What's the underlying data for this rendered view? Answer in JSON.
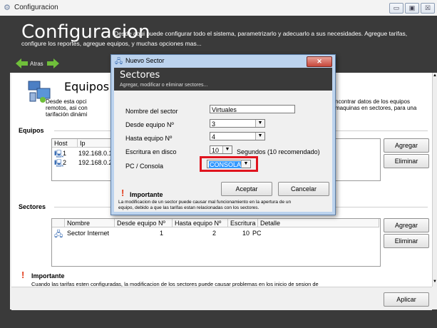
{
  "window": {
    "title": "Configuracion",
    "min_glyph": "▭",
    "max_glyph": "▣",
    "close_glyph": "☒"
  },
  "header": {
    "title": "Configuracion",
    "description_line1": "Desde aqui puede configurar todo el sistema, parametrizarlo y adecuarlo a sus necesidades. Agregue tarifas,",
    "description_line2": "configure los reportes, agregue equipos, y muchas opciones mas..."
  },
  "nav": {
    "back_label": "Atras",
    "back_icon": "arrow-left-icon",
    "forward_icon": "arrow-right-icon",
    "arrow_color": "#6fbf3a"
  },
  "equipos_panel": {
    "title": "Equipos",
    "desc_left_1": "Desde esta opci",
    "desc_left_2": "remotos, asi con",
    "desc_left_3": "tarifación dinámi",
    "desc_right_1": "ncontrar datos de los equipos",
    "desc_right_2": "maquinas en sectores, para una",
    "section_label": "Equipos",
    "columns": [
      "Host",
      "Ip"
    ],
    "rows": [
      {
        "host": "1",
        "ip": "192.168.0.1"
      },
      {
        "host": "2",
        "ip": "192.168.0.2"
      }
    ],
    "add_label": "Agregar",
    "remove_label": "Eliminar"
  },
  "sectores_panel": {
    "section_label": "Sectores",
    "columns": [
      "Nombre",
      "Desde equipo Nº",
      "Hasta equipo Nº",
      "Escritura",
      "Detalle"
    ],
    "rows": [
      {
        "nombre": "Sector Internet",
        "desde": "1",
        "hasta": "2",
        "escritura": "10",
        "detalle": "PC"
      }
    ],
    "add_label": "Agregar",
    "remove_label": "Eliminar"
  },
  "important_main": {
    "title": "Importante",
    "text": "Cuando las tarifas esten configuradas, la modificacion de los sectores puede causar problemas en los inicio de sesion de"
  },
  "apply_label": "Aplicar",
  "dialog": {
    "window_title": "Nuevo Sector",
    "close_glyph": "✕",
    "heading": "Sectores",
    "subheading": "Agregar, modificar o eliminar sectores...",
    "fields": {
      "nombre_label": "Nombre del sector",
      "nombre_value": "Virtuales",
      "desde_label": "Desde equipo Nº",
      "desde_value": "3",
      "hasta_label": "Hasta equipo Nº",
      "hasta_value": "4",
      "escritura_label": "Escritura en disco",
      "escritura_value": "10",
      "escritura_suffix": "Segundos (10 recomendado)",
      "pc_label": "PC / Consola",
      "pc_value": "CONSOLA"
    },
    "accept_label": "Aceptar",
    "cancel_label": "Cancelar",
    "important_title": "Importante",
    "important_text_1": "La modificacion de un sector puede causar mal funcionamiento en la apertura de un",
    "important_text_2": "equipo, debido a que las tarifas estan relacionadas con los sectores.",
    "highlight_color": "#e0141e",
    "selection_color": "#3399ff"
  }
}
